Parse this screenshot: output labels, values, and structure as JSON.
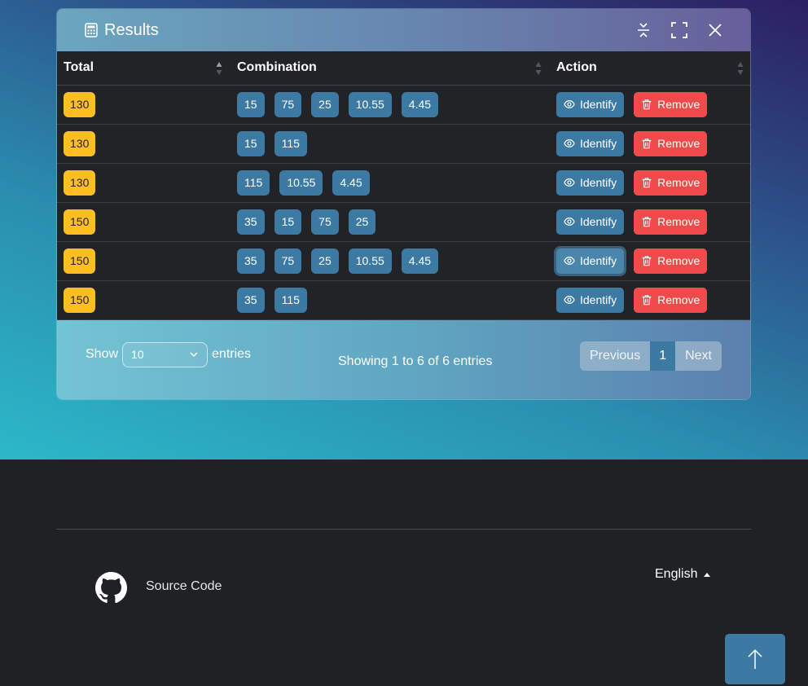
{
  "panel": {
    "title": "Results",
    "title_icon": "calculator-icon",
    "header_buttons": [
      "collapse-icon",
      "fullscreen-icon",
      "close-icon"
    ]
  },
  "table": {
    "columns": [
      "Total",
      "Combination",
      "Action"
    ],
    "rows": [
      {
        "total": "130",
        "combination": [
          "15",
          "75",
          "25",
          "10.55",
          "4.45"
        ]
      },
      {
        "total": "130",
        "combination": [
          "15",
          "115"
        ]
      },
      {
        "total": "130",
        "combination": [
          "115",
          "10.55",
          "4.45"
        ]
      },
      {
        "total": "150",
        "combination": [
          "35",
          "15",
          "75",
          "25"
        ]
      },
      {
        "total": "150",
        "combination": [
          "35",
          "75",
          "25",
          "10.55",
          "4.45"
        ]
      },
      {
        "total": "150",
        "combination": [
          "35",
          "115"
        ]
      }
    ],
    "identify_label": "Identify",
    "remove_label": "Remove"
  },
  "footer": {
    "show_label": "Show",
    "page_size": "10",
    "entries_label": "entries",
    "info": "Showing 1 to 6 of 6 entries",
    "prev_label": "Previous",
    "current_page": "1",
    "next_label": "Next"
  },
  "site_footer": {
    "source_label": "Source Code",
    "language": "English"
  },
  "colors": {
    "total_badge": "#fbbf24",
    "number_badge": "#3c7aa4",
    "remove": "#ef4b4b"
  }
}
